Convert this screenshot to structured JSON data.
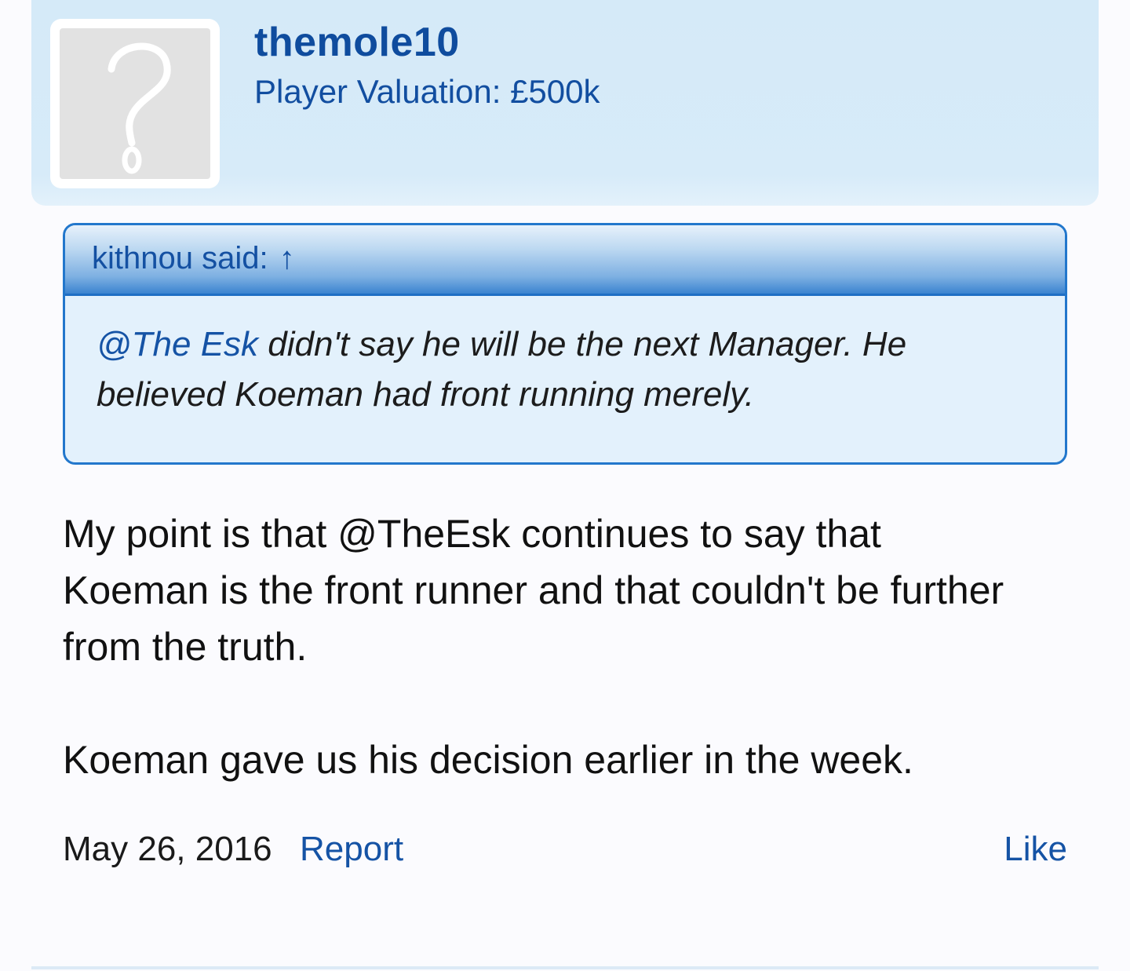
{
  "post": {
    "author": {
      "username": "themole10",
      "valuation": "Player Valuation: £500k",
      "avatar_icon": "question-mark-icon"
    },
    "quote": {
      "header_label": "kithnou said:",
      "arrow_icon": "↑",
      "mention": "@The Esk",
      "text_line1_rest": " didn't say he will be the next Manager. He",
      "text_line2": "believed Koeman had front running merely."
    },
    "body": {
      "paragraph1": "My point is that @TheEsk continues to say that Koeman is the front runner and that couldn't be further from the truth.",
      "paragraph2": "Koeman gave us his decision earlier in the week."
    },
    "footer": {
      "date": "May 26, 2016",
      "report_label": "Report",
      "like_label": "Like"
    }
  },
  "colors": {
    "header_bg": "#d5eaf8",
    "link": "#1553a5",
    "quote_border": "#2277cc",
    "quote_bg": "#e3f1fc"
  }
}
